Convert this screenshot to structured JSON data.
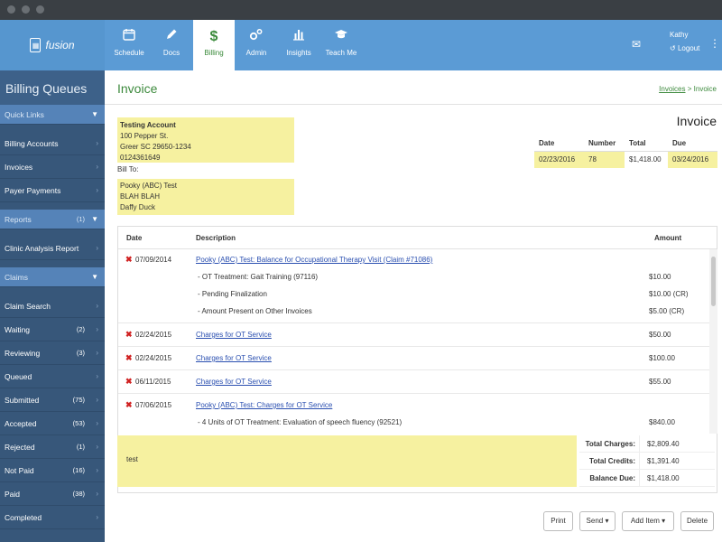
{
  "nav": {
    "logo": "fusion",
    "tabs": [
      {
        "label": "Schedule",
        "icon": "calendar-icon"
      },
      {
        "label": "Docs",
        "icon": "pencil-icon"
      },
      {
        "label": "Billing",
        "icon": "dollar-icon"
      },
      {
        "label": "Admin",
        "icon": "gears-icon"
      },
      {
        "label": "Insights",
        "icon": "bar-chart-icon"
      },
      {
        "label": "Teach Me",
        "icon": "graduation-cap-icon"
      }
    ],
    "user": "Kathy",
    "logout": "Logout"
  },
  "sidebar": {
    "title": "Billing Queues",
    "quick_links": "Quick Links",
    "billing_accounts": "Billing Accounts",
    "invoices": "Invoices",
    "payer_payments": "Payer Payments",
    "reports": "Reports",
    "reports_count": "(1)",
    "clinic_analysis": "Clinic Analysis Report",
    "claims": "Claims",
    "claim_search": "Claim Search",
    "queues": [
      {
        "label": "Waiting",
        "count": "(2)"
      },
      {
        "label": "Reviewing",
        "count": "(3)"
      },
      {
        "label": "Queued",
        "count": ""
      },
      {
        "label": "Submitted",
        "count": "(75)"
      },
      {
        "label": "Accepted",
        "count": "(53)"
      },
      {
        "label": "Rejected",
        "count": "(1)"
      },
      {
        "label": "Not Paid",
        "count": "(16)"
      },
      {
        "label": "Paid",
        "count": "(38)"
      },
      {
        "label": "Completed",
        "count": ""
      }
    ]
  },
  "page": {
    "title": "Invoice",
    "breadcrumb_link": "Invoices",
    "breadcrumb_sep": ">",
    "breadcrumb_current": "Invoice",
    "heading": "Invoice"
  },
  "from": {
    "name": "Testing Account",
    "street": "100 Pepper St.",
    "city": "Greer SC 29650-1234",
    "phone": "0124361649"
  },
  "bill_to": {
    "label": "Bill To:",
    "line1": "Pooky (ABC) Test",
    "line2": "BLAH BLAH",
    "line3": "Daffy Duck"
  },
  "meta": {
    "headers": {
      "date": "Date",
      "number": "Number",
      "total": "Total",
      "due": "Due"
    },
    "date": "02/23/2016",
    "number": "78",
    "total": "$1,418.00",
    "due": "03/24/2016"
  },
  "items_table": {
    "headers": {
      "date": "Date",
      "description": "Description",
      "amount": "Amount"
    },
    "item1": {
      "date": "07/09/2014",
      "desc": "Pooky (ABC) Test: Balance for Occupational Therapy Visit (Claim #71086)",
      "sub1": "- OT Treatment: Gait Training (97116)",
      "amt1": "$10.00",
      "sub2": "- Pending Finalization",
      "amt2": "$10.00 (CR)",
      "sub3": "- Amount Present on Other Invoices",
      "amt3": "$5.00 (CR)"
    },
    "item2": {
      "date": "02/24/2015",
      "desc": "Charges for OT Service",
      "amt": "$50.00"
    },
    "item3": {
      "date": "02/24/2015",
      "desc": "Charges for OT Service",
      "amt": "$100.00"
    },
    "item4": {
      "date": "06/11/2015",
      "desc": "Charges for OT Service",
      "amt": "$55.00"
    },
    "item5": {
      "date": "07/06/2015",
      "desc": "Pooky (ABC) Test: Charges for OT Service",
      "sub1": "- 4 Units of OT Treatment: Evaluation of speech fluency (92521)",
      "amt1": "$840.00"
    }
  },
  "notes": "test",
  "totals": {
    "charges_label": "Total Charges:",
    "charges": "$2,809.40",
    "credits_label": "Total Credits:",
    "credits": "$1,391.40",
    "balance_label": "Balance Due:",
    "balance": "$1,418.00"
  },
  "buttons": {
    "print": "Print",
    "send": "Send ▾",
    "add_item": "Add Item ▾",
    "delete": "Delete"
  }
}
